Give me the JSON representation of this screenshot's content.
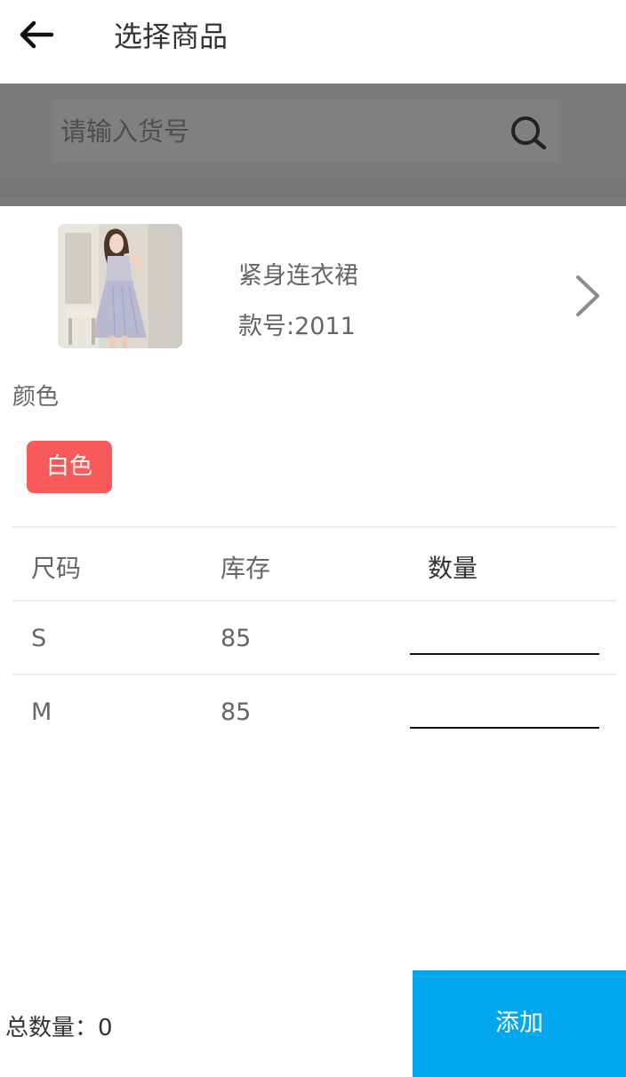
{
  "header": {
    "title": "选择商品",
    "back_icon": "arrow-left-icon"
  },
  "search": {
    "placeholder": "请输入货号",
    "value": "",
    "icon": "search-icon"
  },
  "product": {
    "name": "紧身连衣裙",
    "code": "款号:2011",
    "thumbnail": "dress-photo",
    "chevron_icon": "chevron-right-icon"
  },
  "color": {
    "label": "颜色",
    "options": [
      {
        "label": "白色",
        "selected": true
      }
    ],
    "chip_color": "#f85a5a"
  },
  "table": {
    "headers": [
      "尺码",
      "库存",
      "数量"
    ],
    "rows": [
      {
        "size": "S",
        "stock": "85",
        "quantity": ""
      },
      {
        "size": "M",
        "stock": "85",
        "quantity": ""
      }
    ]
  },
  "footer": {
    "total": "总数量：0",
    "add_label": "添加",
    "add_color": "#02a7ef"
  }
}
